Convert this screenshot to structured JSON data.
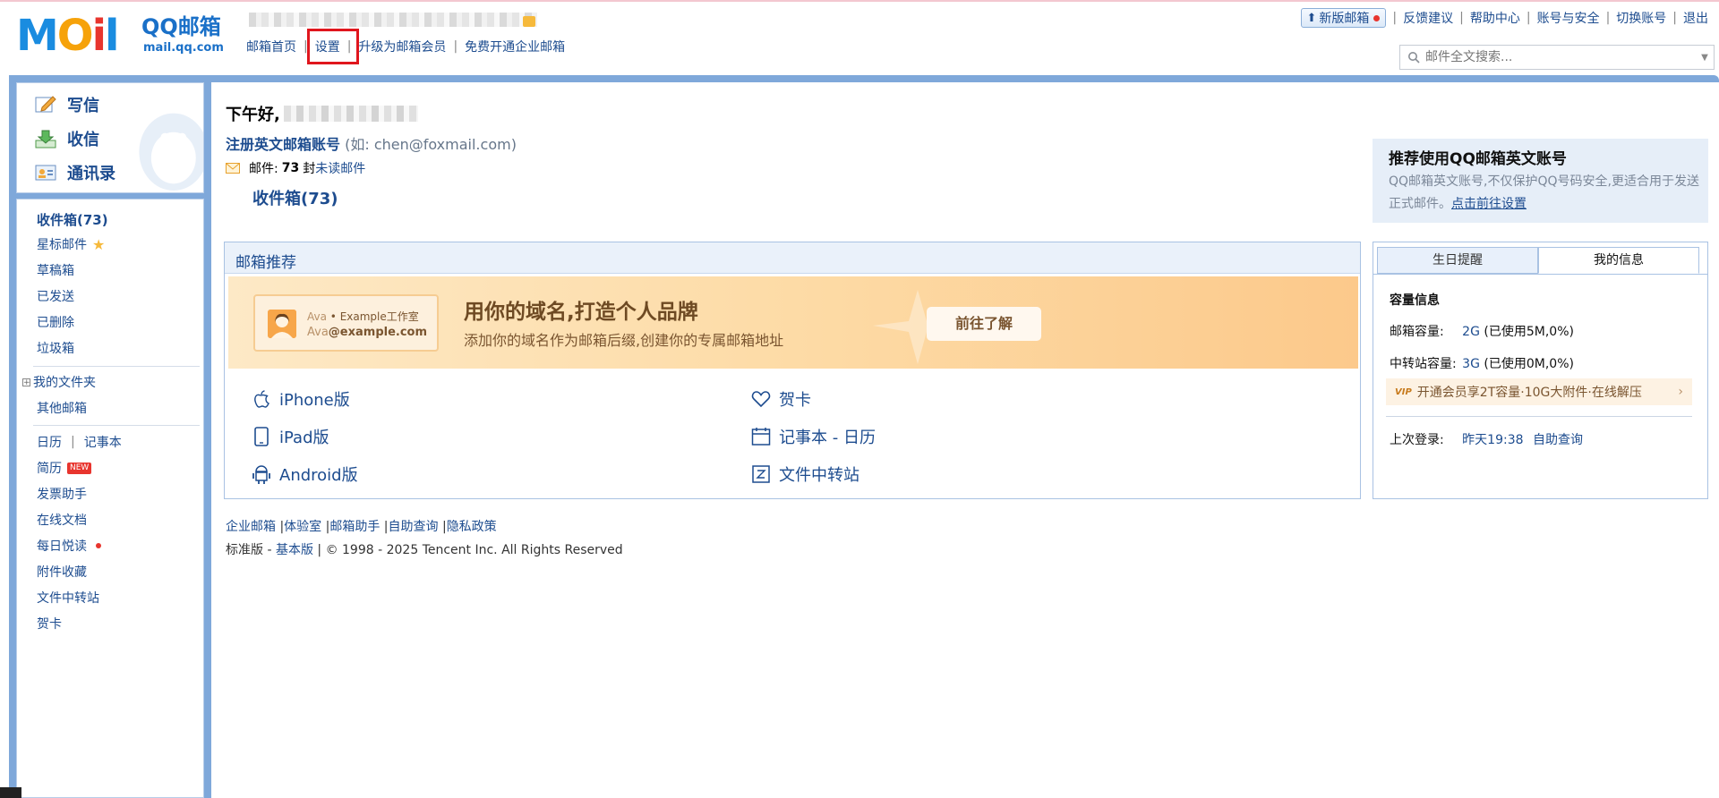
{
  "header": {
    "logo_text": "MOil",
    "logo_brand": "QQ邮箱",
    "logo_domain": "mail.qq.com",
    "nav": [
      "邮箱首页",
      "设置",
      "升级为邮箱会员",
      "免费开通企业邮箱"
    ],
    "right_links": {
      "new_mail": "新版邮箱",
      "feedback": "反馈建议",
      "help": "帮助中心",
      "account_security": "账号与安全",
      "switch_account": "切换账号",
      "logout": "退出"
    },
    "search_placeholder": "邮件全文搜索..."
  },
  "sidebar": {
    "actions": [
      "写信",
      "收信",
      "通讯录"
    ],
    "folders": {
      "inbox": "收件箱(73)",
      "starred": "星标邮件",
      "drafts": "草稿箱",
      "sent": "已发送",
      "deleted": "已删除",
      "spam": "垃圾箱",
      "my_folders": "我的文件夹",
      "other_mail": "其他邮箱",
      "calendar": "日历",
      "notes": "记事本",
      "resume": "简历",
      "resume_badge": "NEW",
      "invoice": "发票助手",
      "docs": "在线文档",
      "daily_read": "每日悦读",
      "attachments": "附件收藏",
      "transfer": "文件中转站",
      "cards": "贺卡"
    }
  },
  "main": {
    "greeting": "下午好,",
    "register_label": "注册英文邮箱账号",
    "register_hint": "(如: chen@foxmail.com)",
    "mail_prefix": "邮件:",
    "mail_count": "73",
    "mail_unit": "封",
    "unread_link": "未读邮件",
    "inbox_link": "收件箱(73)",
    "promo": {
      "title": "推荐使用QQ邮箱英文账号",
      "text": "QQ邮箱英文账号,不仅保护QQ号码安全,更适合用于发送正式邮件。",
      "link": "点击前往设置"
    },
    "recommend": {
      "title": "邮箱推荐",
      "banner": {
        "card_name": "Ava",
        "card_org": "• Example工作室",
        "card_email_user": "Ava",
        "card_email_domain": "@example.com",
        "headline": "用你的域名,打造个人品牌",
        "subline": "添加你的域名作为邮箱后缀,创建你的专属邮箱地址",
        "button": "前往了解"
      },
      "apps": {
        "iphone": "iPhone版",
        "ipad": "iPad版",
        "android": "Android版",
        "greeting_card": "贺卡",
        "notes_calendar": "记事本 - 日历",
        "file_transfer": "文件中转站"
      }
    },
    "footer": {
      "links": [
        "企业邮箱",
        "体验室",
        "邮箱助手",
        "自助查询",
        "隐私政策"
      ],
      "edition": "标准版",
      "basic": "基本版",
      "copyright": "© 1998 - 2025 Tencent Inc. All Rights Reserved"
    }
  },
  "info_panel": {
    "tabs": [
      "生日提醒",
      "我的信息"
    ],
    "capacity_title": "容量信息",
    "mailbox_label": "邮箱容量:",
    "mailbox_size": "2G",
    "mailbox_used": "(已使用5M,0%)",
    "transfer_label": "中转站容量:",
    "transfer_size": "3G",
    "transfer_used": "(已使用0M,0%)",
    "vip_icon": "VIP",
    "vip_text": "开通会员享2T容量·10G大附件·在线解压",
    "last_login_label": "上次登录:",
    "last_login_time": "昨天19:38",
    "self_query": "自助查询"
  },
  "colors": {
    "link": "#1d4c8f",
    "frame": "#7fa8da",
    "highlight_box": "#e0161d"
  }
}
